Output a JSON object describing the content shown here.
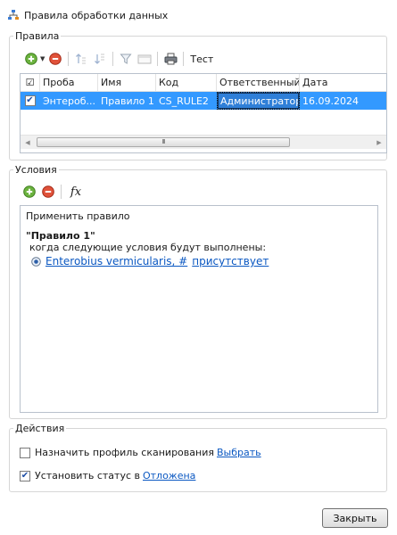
{
  "window": {
    "title": "Правила обработки данных"
  },
  "rules": {
    "legend": "Правила",
    "toolbar": {
      "test_label": "Тест"
    },
    "columns": [
      "Проба",
      "Имя",
      "Код",
      "Ответственный",
      "Дата"
    ],
    "rows": [
      {
        "checked": true,
        "probe": "Энтероб...",
        "name": "Правило 1",
        "code": "CS_RULE2",
        "responsible": "Администратор",
        "date": "16.09.2024"
      }
    ],
    "scrollbar_thumb_grip": "III"
  },
  "conditions": {
    "legend": "Условия",
    "toolbar": {
      "fx_label": "fx"
    },
    "apply_rule": "Применить правило",
    "rule_name": "\"Правило 1\"",
    "when_text": "когда следующие условия будут выполнены:",
    "item_subject": "Enterobius vermicularis, #",
    "item_state": "присутствует"
  },
  "actions": {
    "legend": "Действия",
    "items": [
      {
        "checked": false,
        "text": "Назначить профиль сканирования",
        "link": "Выбрать"
      },
      {
        "checked": true,
        "text": "Установить статус в",
        "link": "Отложена"
      }
    ]
  },
  "footer": {
    "close_label": "Закрыть"
  },
  "colors": {
    "selection": "#3399ff",
    "link": "#0b58c2",
    "add": "#5aa02c",
    "remove": "#d8452c"
  }
}
